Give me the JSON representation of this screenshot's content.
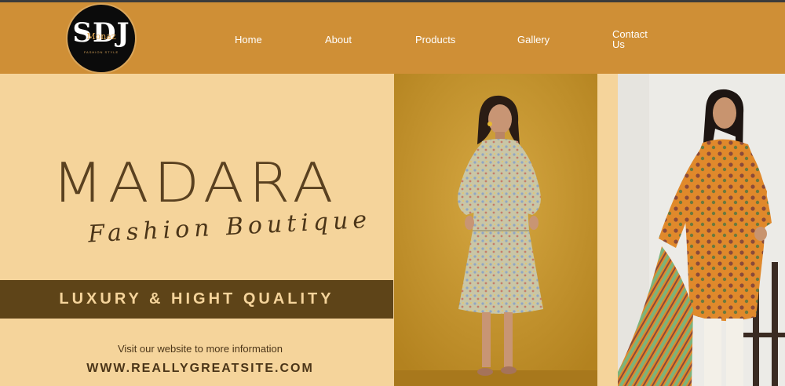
{
  "logo": {
    "monogram": "SDJ",
    "name": "Monaz",
    "tagline": "FASHION STYLE"
  },
  "nav": {
    "home": "Home",
    "about": "About",
    "products": "Products",
    "gallery": "Gallery",
    "contact": "Contact Us"
  },
  "banner": {
    "brand": "MADARA",
    "tagline": "Fashion Boutique",
    "quality": "LUXURY & HIGHT QUALITY",
    "visit": "Visit our website to more information",
    "site": "WWW.REALLYGREATSITE.COM"
  },
  "colors": {
    "header": "#cf8f36",
    "banner_bg": "#f5d49b",
    "quality_band": "#5e4418",
    "text_brown": "#5a4120"
  },
  "photos": [
    {
      "name": "model-floral-dress-photo"
    },
    {
      "name": "model-orange-kurta-photo"
    }
  ]
}
